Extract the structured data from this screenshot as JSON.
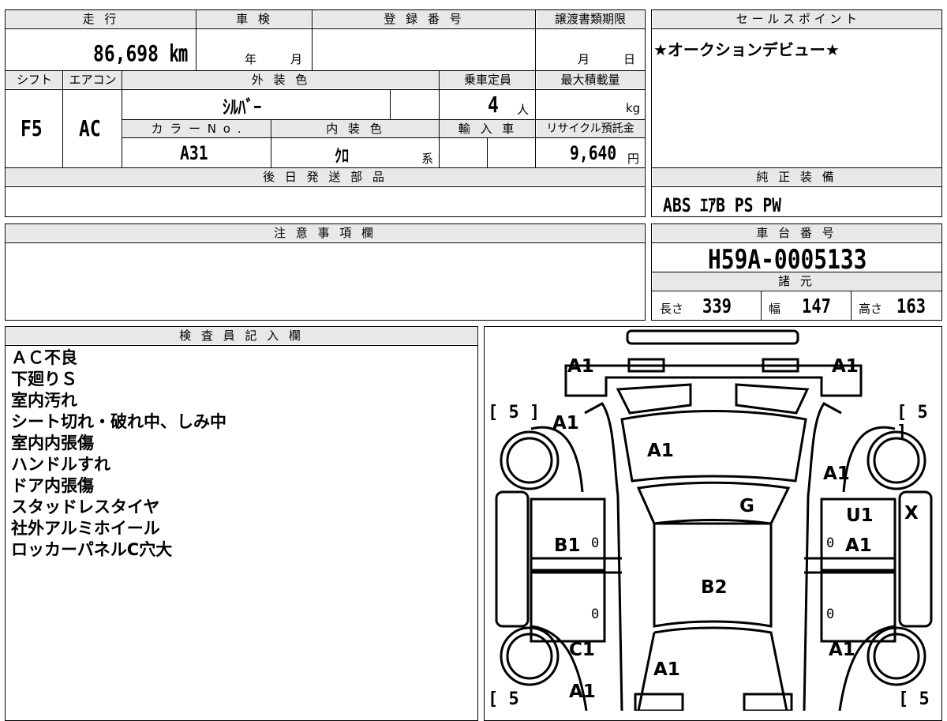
{
  "headers": {
    "mileage": "走 行",
    "inspection": "車 検",
    "registration_no": "登 録 番 号",
    "transfer_deadline": "譲渡書類期限",
    "sales_point": "セ ー ル ス ポ イ ン ト",
    "shift": "シフト",
    "aircon": "エアコン",
    "exterior_color": "外 装 色",
    "capacity": "乗車定員",
    "max_load": "最大積載量",
    "color_no": "カ ラ ー N o .",
    "interior_color": "内 装 色",
    "import": "輸 入 車",
    "recycle_fee": "リサイクル預託金",
    "later_parts": "後 日 発 送 部 品",
    "genuine_equipment": "純 正 装 備",
    "caution": "注 意 事 項 欄",
    "chassis_no": "車 台 番 号",
    "specs": "諸 元",
    "inspector_notes": "検 査 員 記 入 欄"
  },
  "vehicle": {
    "mileage": "86,698 ㎞",
    "inspection_year_unit": "年",
    "inspection_month_unit": "月",
    "transfer_month_unit": "月",
    "transfer_day_unit": "日",
    "shift": "F5",
    "aircon": "AC",
    "exterior_color": "ｼﾙﾊﾞｰ",
    "capacity": "4",
    "capacity_unit": "人",
    "max_load_unit": "kg",
    "color_no": "A31",
    "interior_color": "ｸﾛ",
    "interior_suffix": "系",
    "recycle_fee": "9,640",
    "recycle_unit": "円",
    "sales_point": "★オークションデビュー★",
    "genuine_equipment": "ABS ｴｱB PS PW",
    "chassis_no": "H59A-0005133",
    "length_label": "長さ",
    "length": "339",
    "width_label": "幅",
    "width": "147",
    "height_label": "高さ",
    "height": "163"
  },
  "inspector_notes": [
    "ＡＣ不良",
    "下廻りＳ",
    "室内汚れ",
    "シート切れ・破れ中、しみ中",
    "室内内張傷",
    "ハンドルすれ",
    "ドア内張傷",
    "スタッドレスタイヤ",
    "社外アルミホイール",
    "ロッカーパネルC穴大"
  ],
  "diagram": {
    "marks": {
      "front_left": "A1",
      "front_right": "A1",
      "hood": "A1",
      "left_front_fender": "A1",
      "right_front_fender": "A1",
      "windshield": "G",
      "right_front_door_a": "U1",
      "right_front_door_b": "A1",
      "right_edge": "X",
      "left_front_door": "B1",
      "roof": "B2",
      "left_rear_fender": "C1",
      "rear_glass": "A1",
      "left_rear": "A1",
      "right_rear_fender": "A1"
    },
    "tire_depth_labels": [
      "[ 5 ]",
      "[ 5 ]",
      "[ 5",
      "[ 5"
    ],
    "zero_marks": [
      "0",
      "0",
      "0",
      "0"
    ]
  }
}
